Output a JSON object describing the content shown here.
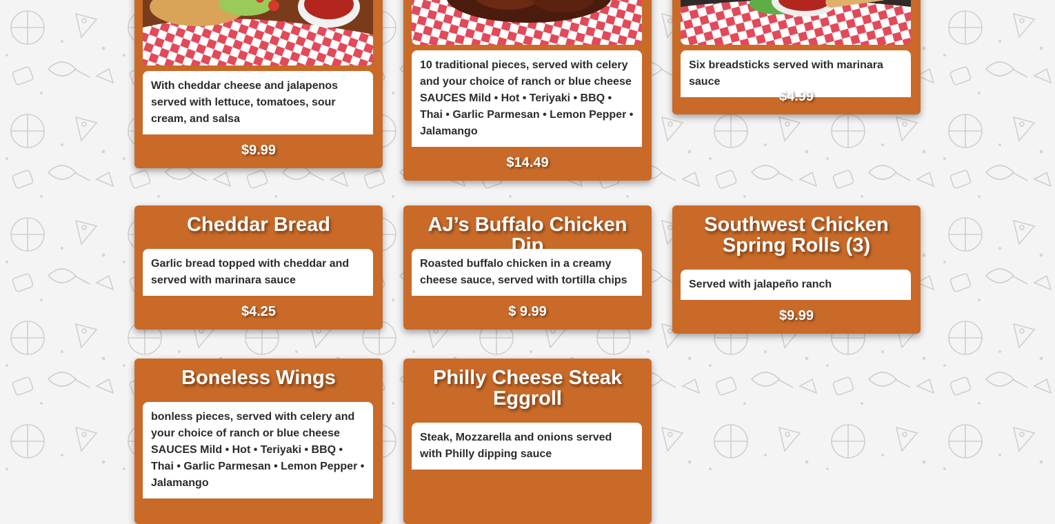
{
  "menu": {
    "items": [
      {
        "title": "",
        "description": "With cheddar cheese and jalapenos served with lettuce, tomatoes, sour cream, and salsa",
        "price": "$9.99",
        "photo": "nachos-photo"
      },
      {
        "title": "",
        "description": "10 traditional pieces, served with celery and your choice of ranch or blue cheese SAUCES Mild • Hot • Teriyaki • BBQ • Thai • Garlic Parmesan • Lemon Pepper • Jalamango",
        "price": "$14.49",
        "photo": "wings-photo"
      },
      {
        "title": "",
        "description": "Six breadsticks served with marinara sauce",
        "price": "$4.99",
        "photo": "breadsticks-photo"
      },
      {
        "title": "Cheddar Bread",
        "description": "Garlic bread topped with cheddar and served with marinara sauce",
        "price": "$4.25"
      },
      {
        "title": "AJ’s Buffalo Chicken Dip",
        "description": "Roasted buffalo chicken in a creamy cheese sauce, served with tortilla chips",
        "price": "$ 9.99"
      },
      {
        "title": "Southwest Chicken Spring Rolls (3)",
        "description": "Served with jalapeño ranch",
        "price": "$9.99"
      },
      {
        "title": "Boneless Wings",
        "description": "bonless pieces, served with celery and your choice of ranch or blue cheese SAUCES Mild • Hot • Teriyaki • BBQ • Thai • Garlic Parmesan • Lemon Pepper • Jalamango",
        "price": ""
      },
      {
        "title": "Philly Cheese Steak Eggroll",
        "description": "Steak, Mozzarella and onions served with Philly dipping sauce",
        "price": ""
      }
    ]
  },
  "colors": {
    "card": "#c96a28",
    "checker_red": "#e24a5a",
    "background": "#f4f4f4"
  }
}
